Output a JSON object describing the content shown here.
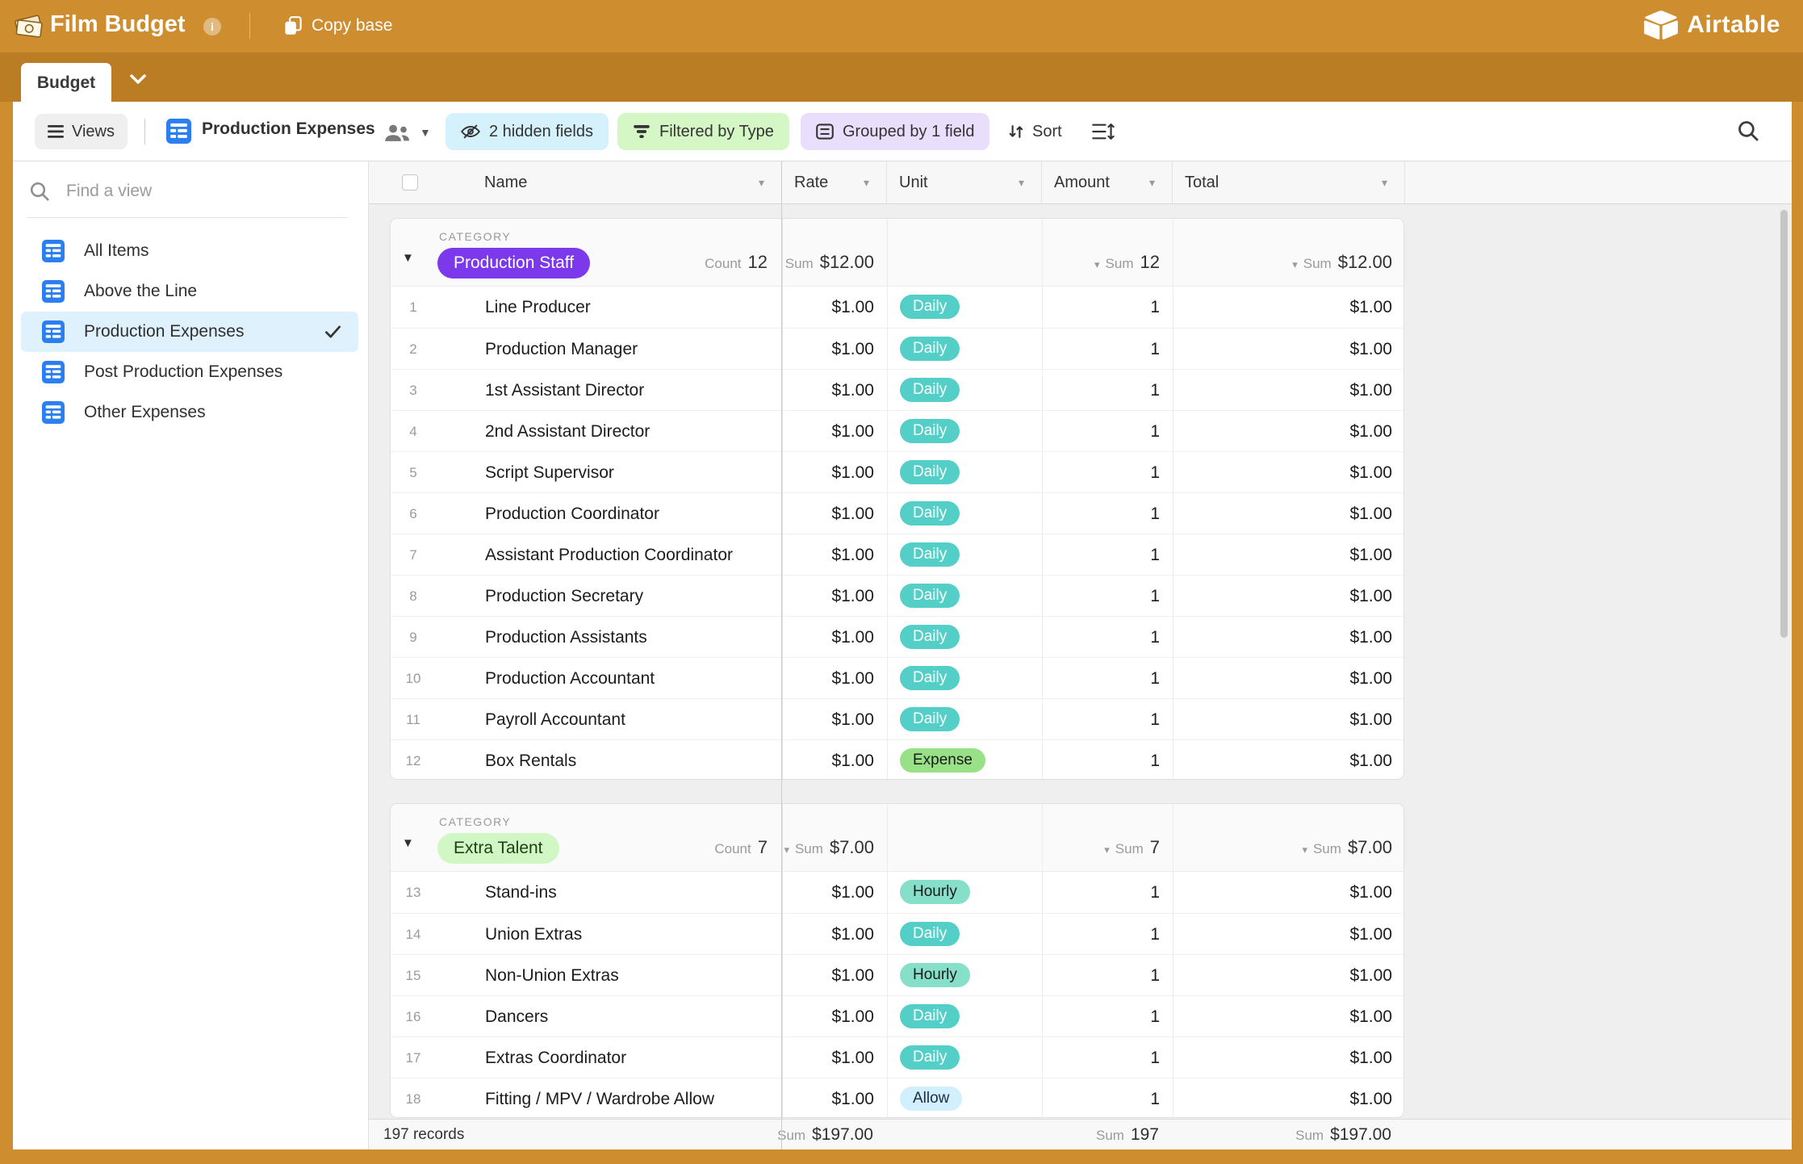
{
  "header": {
    "title": "Film Budget",
    "copy_base_label": "Copy base",
    "brand": "Airtable",
    "tab_label": "Budget"
  },
  "toolbar": {
    "views_label": "Views",
    "view_name": "Production Expenses",
    "hidden_fields_label": "2 hidden fields",
    "filter_label": "Filtered by Type",
    "group_label": "Grouped by 1 field",
    "sort_label": "Sort"
  },
  "sidebar": {
    "search_placeholder": "Find a view",
    "items": [
      {
        "label": "All Items",
        "selected": false
      },
      {
        "label": "Above the Line",
        "selected": false
      },
      {
        "label": "Production Expenses",
        "selected": true
      },
      {
        "label": "Post Production Expenses",
        "selected": false
      },
      {
        "label": "Other Expenses",
        "selected": false
      }
    ]
  },
  "grid": {
    "columns": [
      "Name",
      "Rate",
      "Unit",
      "Amount",
      "Total"
    ],
    "groups": [
      {
        "category_tag": "CATEGORY",
        "name": "Production Staff",
        "pill": {
          "bg": "#7C39EC",
          "text": "#FFFFFF"
        },
        "count": {
          "label": "Count",
          "value": "12"
        },
        "sums": {
          "rate": {
            "label": "Sum",
            "value": "$12.00",
            "chevron": false
          },
          "amount": {
            "label": "Sum",
            "value": "12",
            "chevron": true
          },
          "total": {
            "label": "Sum",
            "value": "$12.00",
            "chevron": true
          }
        },
        "rows": [
          {
            "num": "1",
            "name": "Line Producer",
            "rate": "$1.00",
            "unit": "Daily",
            "amount": "1",
            "total": "$1.00"
          },
          {
            "num": "2",
            "name": "Production Manager",
            "rate": "$1.00",
            "unit": "Daily",
            "amount": "1",
            "total": "$1.00"
          },
          {
            "num": "3",
            "name": "1st Assistant Director",
            "rate": "$1.00",
            "unit": "Daily",
            "amount": "1",
            "total": "$1.00"
          },
          {
            "num": "4",
            "name": "2nd Assistant Director",
            "rate": "$1.00",
            "unit": "Daily",
            "amount": "1",
            "total": "$1.00"
          },
          {
            "num": "5",
            "name": "Script Supervisor",
            "rate": "$1.00",
            "unit": "Daily",
            "amount": "1",
            "total": "$1.00"
          },
          {
            "num": "6",
            "name": "Production Coordinator",
            "rate": "$1.00",
            "unit": "Daily",
            "amount": "1",
            "total": "$1.00"
          },
          {
            "num": "7",
            "name": "Assistant Production Coordinator",
            "rate": "$1.00",
            "unit": "Daily",
            "amount": "1",
            "total": "$1.00"
          },
          {
            "num": "8",
            "name": "Production Secretary",
            "rate": "$1.00",
            "unit": "Daily",
            "amount": "1",
            "total": "$1.00"
          },
          {
            "num": "9",
            "name": "Production Assistants",
            "rate": "$1.00",
            "unit": "Daily",
            "amount": "1",
            "total": "$1.00"
          },
          {
            "num": "10",
            "name": "Production Accountant",
            "rate": "$1.00",
            "unit": "Daily",
            "amount": "1",
            "total": "$1.00"
          },
          {
            "num": "11",
            "name": "Payroll Accountant",
            "rate": "$1.00",
            "unit": "Daily",
            "amount": "1",
            "total": "$1.00"
          },
          {
            "num": "12",
            "name": "Box Rentals",
            "rate": "$1.00",
            "unit": "Expense",
            "amount": "1",
            "total": "$1.00"
          }
        ]
      },
      {
        "category_tag": "CATEGORY",
        "name": "Extra Talent",
        "pill": {
          "bg": "#D1F7C4",
          "text": "#1E3D14"
        },
        "count": {
          "label": "Count",
          "value": "7"
        },
        "sums": {
          "rate": {
            "label": "Sum",
            "value": "$7.00",
            "chevron": true
          },
          "amount": {
            "label": "Sum",
            "value": "7",
            "chevron": true
          },
          "total": {
            "label": "Sum",
            "value": "$7.00",
            "chevron": true
          }
        },
        "rows": [
          {
            "num": "13",
            "name": "Stand-ins",
            "rate": "$1.00",
            "unit": "Hourly",
            "amount": "1",
            "total": "$1.00"
          },
          {
            "num": "14",
            "name": "Union Extras",
            "rate": "$1.00",
            "unit": "Daily",
            "amount": "1",
            "total": "$1.00"
          },
          {
            "num": "15",
            "name": "Non-Union Extras",
            "rate": "$1.00",
            "unit": "Hourly",
            "amount": "1",
            "total": "$1.00"
          },
          {
            "num": "16",
            "name": "Dancers",
            "rate": "$1.00",
            "unit": "Daily",
            "amount": "1",
            "total": "$1.00"
          },
          {
            "num": "17",
            "name": "Extras Coordinator",
            "rate": "$1.00",
            "unit": "Daily",
            "amount": "1",
            "total": "$1.00"
          },
          {
            "num": "18",
            "name": "Fitting / MPV / Wardrobe Allow",
            "rate": "$1.00",
            "unit": "Allow",
            "amount": "1",
            "total": "$1.00"
          }
        ]
      }
    ],
    "footer": {
      "records": "197 records",
      "cells": [
        {
          "label": "Sum",
          "value": "$197.00"
        },
        {
          "label": "Sum",
          "value": "197"
        },
        {
          "label": "Sum",
          "value": "$197.00"
        }
      ]
    }
  },
  "unit_styles": {
    "Daily": {
      "bg": "#53CFC7",
      "text": "#FFFFFF"
    },
    "Hourly": {
      "bg": "#86DFC8",
      "text": "#1A1A1A"
    },
    "Expense": {
      "bg": "#98E186",
      "text": "#1A1A1A"
    },
    "Allow": {
      "bg": "#D2EFFD",
      "text": "#1B2B4B"
    }
  },
  "colors": {
    "header_bg": "#CE8D2F",
    "tabstrip_bg": "#BA7D24",
    "accent_blue": "#2B7FF0",
    "hidden_pill_bg": "#D5F1FB",
    "filter_pill_bg": "#D4F7C5",
    "group_pill_bg": "#E9DFFD",
    "selected_view_bg": "#DFF1FD"
  }
}
